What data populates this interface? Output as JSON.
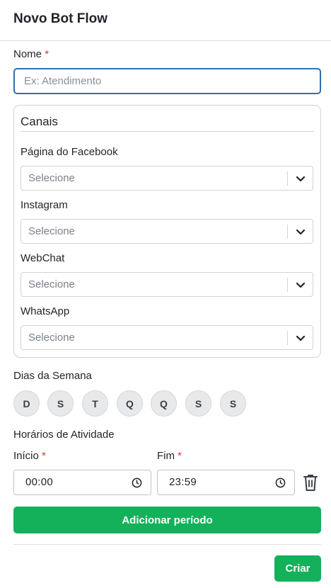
{
  "header": {
    "title": "Novo Bot Flow"
  },
  "name_field": {
    "label": "Nome",
    "required_mark": "*",
    "placeholder": "Ex: Atendimento",
    "value": ""
  },
  "channels": {
    "title": "Canais",
    "items": [
      {
        "label": "Página do Facebook",
        "placeholder": "Selecione"
      },
      {
        "label": "Instagram",
        "placeholder": "Selecione"
      },
      {
        "label": "WebChat",
        "placeholder": "Selecione"
      },
      {
        "label": "WhatsApp",
        "placeholder": "Selecione"
      }
    ]
  },
  "weekdays": {
    "label": "Dias da Semana",
    "days": [
      "D",
      "S",
      "T",
      "Q",
      "Q",
      "S",
      "S"
    ]
  },
  "schedule": {
    "label": "Horários de Atividade",
    "start_label": "Início",
    "end_label": "Fim",
    "required_mark": "*",
    "start_value": "00:00",
    "end_value": "23:59",
    "add_period_label": "Adicionar período"
  },
  "footer": {
    "create_label": "Criar"
  },
  "colors": {
    "accent": "#14b15a",
    "focus": "#2f6fb0",
    "required": "#e03131"
  }
}
